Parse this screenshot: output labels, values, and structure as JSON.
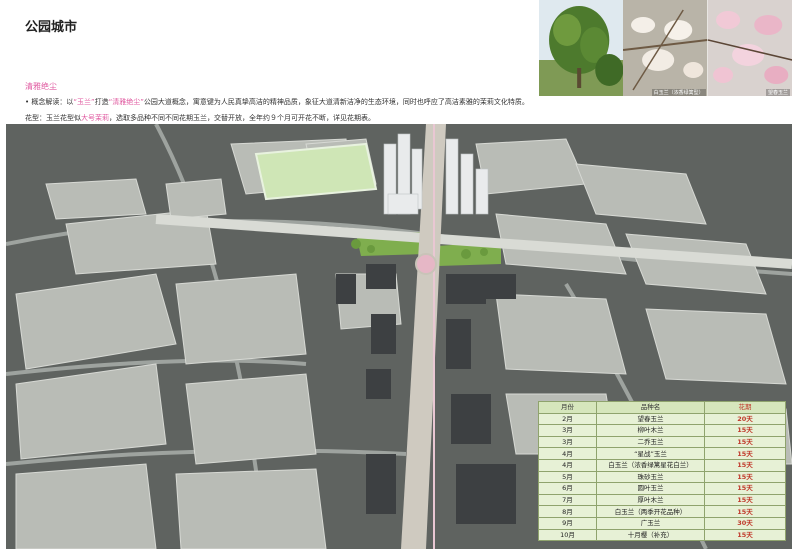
{
  "title": "公园城市",
  "photos": [
    {
      "icon": "magnolia-tree-photo",
      "caption": ""
    },
    {
      "icon": "white-magnolia-flower-photo",
      "caption": "白玉兰（浓香绿篱型）"
    },
    {
      "icon": "pink-magnolia-flower-photo",
      "caption": "望春玉兰"
    }
  ],
  "tagline": "清雅绝尘",
  "concept": {
    "bullet": "•",
    "prefix": "概念解读：以",
    "q1": "“玉兰”",
    "mid": "打造",
    "q2": "“清雅绝尘”",
    "rest": "公园大道概念，寓意键为人民真挚高洁的精神品质，象征大道清新洁净的生态环境，同时也呼应了高洁素雅的茉莉文化特质。"
  },
  "flower": {
    "prefix": "花型：玉兰花型似",
    "highlight": "大号茉莉",
    "rest": "，选取多品种不同不同花期玉兰，交替开放，全年约９个月可开花不断，详见花期表。"
  },
  "bloom_table": {
    "headers": [
      "月份",
      "品种名",
      "花期"
    ],
    "rows": [
      {
        "month": "2月",
        "variety": "望春玉兰",
        "period": "20天"
      },
      {
        "month": "3月",
        "variety": "柳叶木兰",
        "period": "15天"
      },
      {
        "month": "3月",
        "variety": "二乔玉兰",
        "period": "15天"
      },
      {
        "month": "4月",
        "variety": "“星战”玉兰",
        "period": "15天"
      },
      {
        "month": "4月",
        "variety": "白玉兰（浓香绿篱星花白兰）",
        "period": "15天"
      },
      {
        "month": "5月",
        "variety": "珠砂玉兰",
        "period": "15天"
      },
      {
        "month": "6月",
        "variety": "圆叶玉兰",
        "period": "15天"
      },
      {
        "month": "7月",
        "variety": "厚叶木兰",
        "period": "15天"
      },
      {
        "month": "8月",
        "variety": "白玉兰（两季开花品种）",
        "period": "15天"
      },
      {
        "month": "9月",
        "variety": "广玉兰",
        "period": "30天"
      },
      {
        "month": "10月",
        "variety": "十月樱（补充）",
        "period": "15天"
      }
    ]
  },
  "colors": {
    "accent_pink": "#e05aa0",
    "period_red": "#c0392b",
    "table_bg": "#e7f1d6"
  }
}
